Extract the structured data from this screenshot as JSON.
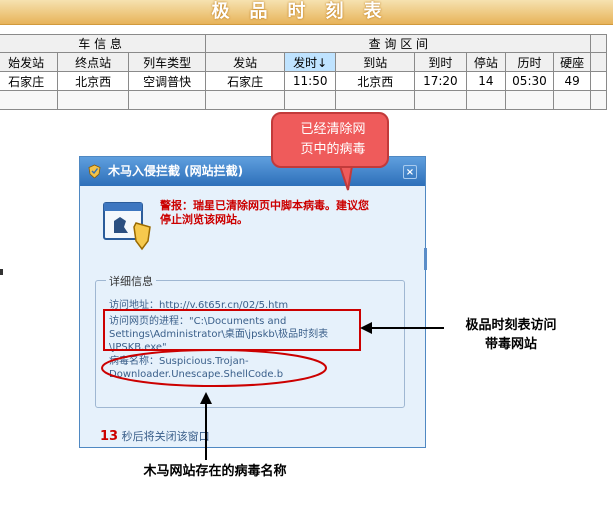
{
  "banner": {
    "title": "极品时刻表"
  },
  "table": {
    "groups": [
      "车 信 息",
      "查 询 区 间"
    ],
    "headers": [
      "始发站",
      "终点站",
      "列车类型",
      "发站",
      "发时↓",
      "到站",
      "到时",
      "停站",
      "历时",
      "硬座"
    ],
    "row": [
      "石家庄",
      "北京西",
      "空调普快",
      "石家庄",
      "11:50",
      "北京西",
      "17:20",
      "14",
      "05:30",
      "49"
    ]
  },
  "dialog": {
    "title": "木马入侵拦截 (网站拦截)",
    "close": "×",
    "warning_line1": "警报：瑞星已清除网页中脚本病毒。建议您",
    "warning_line2": "停止浏览该网站。",
    "fieldset_legend": "详细信息",
    "visit_line": "访问地址：http://v.6t65r.cn/02/5.htm",
    "process_line1": "访问网页的进程：\"C:\\Documents and",
    "process_line2": "Settings\\Administrator\\桌面\\jpskb\\极品时刻表",
    "process_line3": "\\JPSKB.exe\"",
    "virus_line1": "病毒名称：Suspicious.Trojan-",
    "virus_line2": "Downloader.Unescape.ShellCode.b",
    "countdown_num": "13",
    "countdown_text": " 秒后将关闭该窗口"
  },
  "annotations": {
    "bubble_line1": "已经清除网",
    "bubble_line2": "页中的病毒",
    "right_line1": "极品时刻表访问",
    "right_line2": "带毒网站",
    "bottom": "木马网站存在的病毒名称"
  },
  "colors": {
    "highlight_red": "#cc0000",
    "bubble_red": "#ef5b5b",
    "dialog_blue": "#2d6fb9"
  },
  "icons": [
    "rising-shield-icon",
    "close-icon"
  ]
}
